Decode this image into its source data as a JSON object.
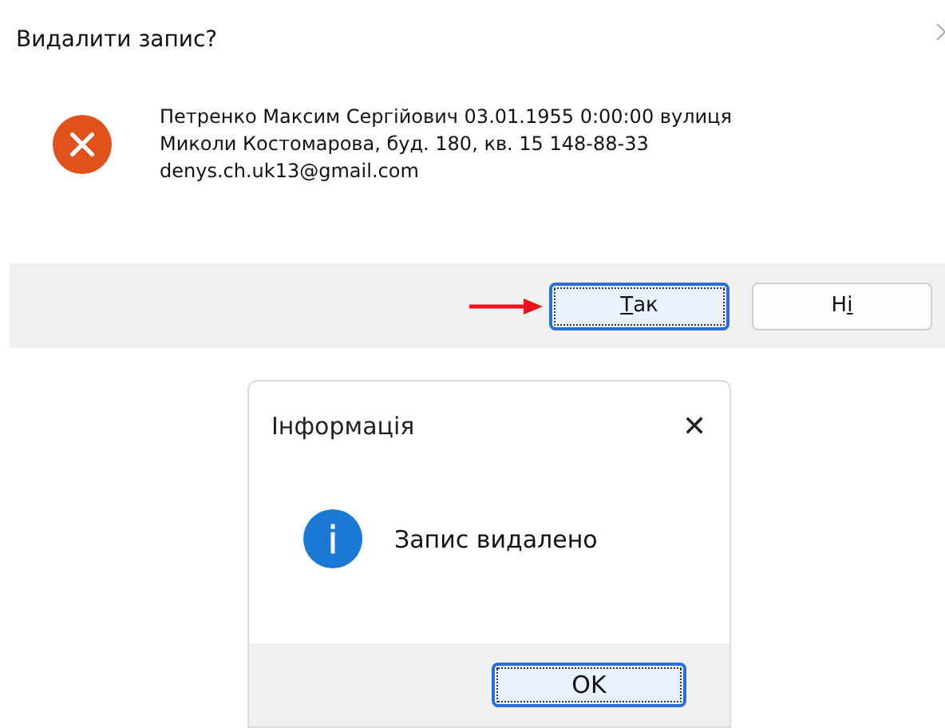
{
  "confirm_dialog": {
    "title": "Видалити запис?",
    "kind": "error",
    "message_lines": [
      "Петренко Максим Сергійович 03.01.1955 0:00:00 вулиця",
      "Миколи Костомарова, буд. 180, кв. 15 148-88-33",
      "denys.ch.uk13@gmail.com"
    ],
    "buttons": [
      {
        "label": "Так",
        "kind": "first_underlined",
        "default": true,
        "pointer_arrow": true
      },
      {
        "label": "Ні",
        "kind": "last_underlined",
        "default": false,
        "pointer_arrow": false
      }
    ]
  },
  "info_dialog": {
    "title": "Інформація",
    "close": "✕",
    "kind": "info",
    "message": "Запис видалено",
    "buttons": [
      {
        "label": "OK",
        "kind": "plain",
        "default": true,
        "pointer_arrow": false
      }
    ]
  }
}
